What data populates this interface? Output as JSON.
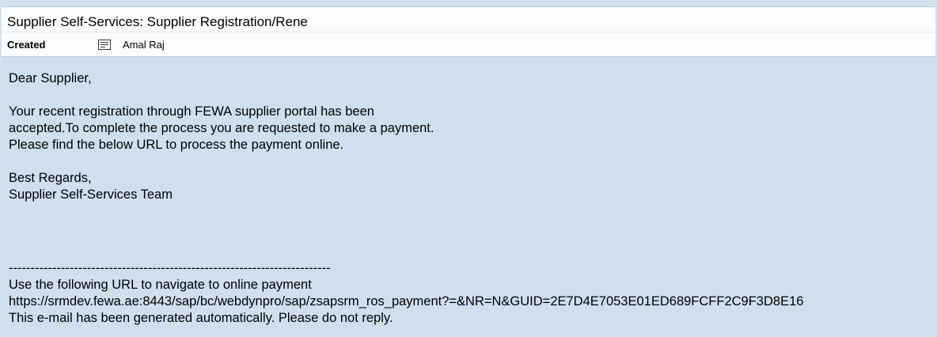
{
  "email": {
    "subject": "Supplier Self-Services: Supplier Registration/Rene",
    "meta": {
      "label": "Created",
      "author_icon": "note-icon",
      "author": "Amal Raj"
    },
    "body": {
      "greeting": "Dear Supplier,",
      "paragraph_lines": [
        "Your recent registration through FEWA supplier portal has been",
        "accepted.To complete the process you are requested to make a payment.",
        "Please find the below URL to process the payment online."
      ],
      "closing": "Best Regards,",
      "signature": "Supplier Self-Services Team",
      "separator": "--------------------------------------------------------------------------",
      "url_intro": "Use the following URL to navigate to online payment",
      "url": "https://srmdev.fewa.ae:8443/sap/bc/webdynpro/sap/zsapsrm_ros_payment?=&NR=N&GUID=2E7D4E7053E01ED689FCFF2C9F3D8E16",
      "footer": "This e-mail has been generated automatically. Please do not reply."
    }
  }
}
